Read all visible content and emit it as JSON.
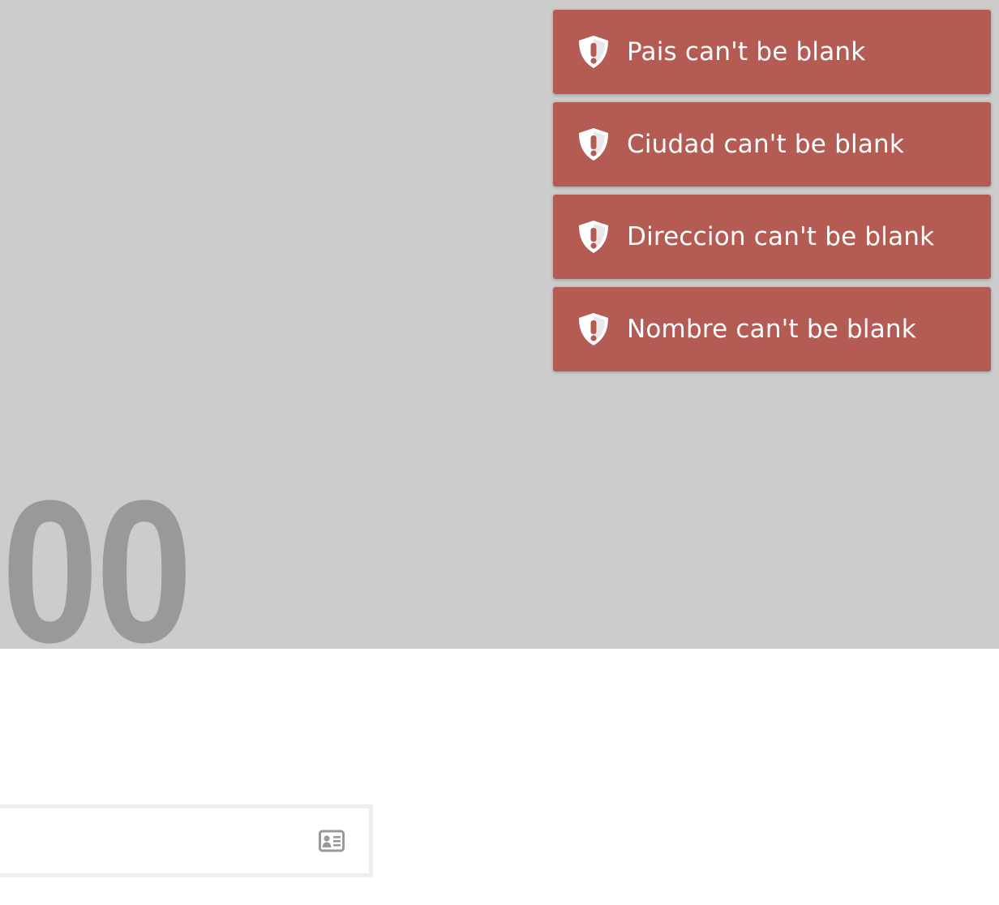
{
  "hero": {
    "number_text": "00",
    "background_color": "#cccccc",
    "number_color": "#999999"
  },
  "menu": {
    "icon": "hamburger-menu-icon",
    "color": "#9a3b34"
  },
  "toasts": {
    "background_color": "#b45c54",
    "icon": "shield-exclamation-icon",
    "items": [
      {
        "message": "Pais can't be blank"
      },
      {
        "message": "Ciudad can't be blank"
      },
      {
        "message": "Direccion can't be blank"
      },
      {
        "message": "Nombre can't be blank"
      }
    ]
  },
  "form": {
    "field": {
      "value": "",
      "placeholder": "",
      "icon": "address-card-icon"
    }
  }
}
